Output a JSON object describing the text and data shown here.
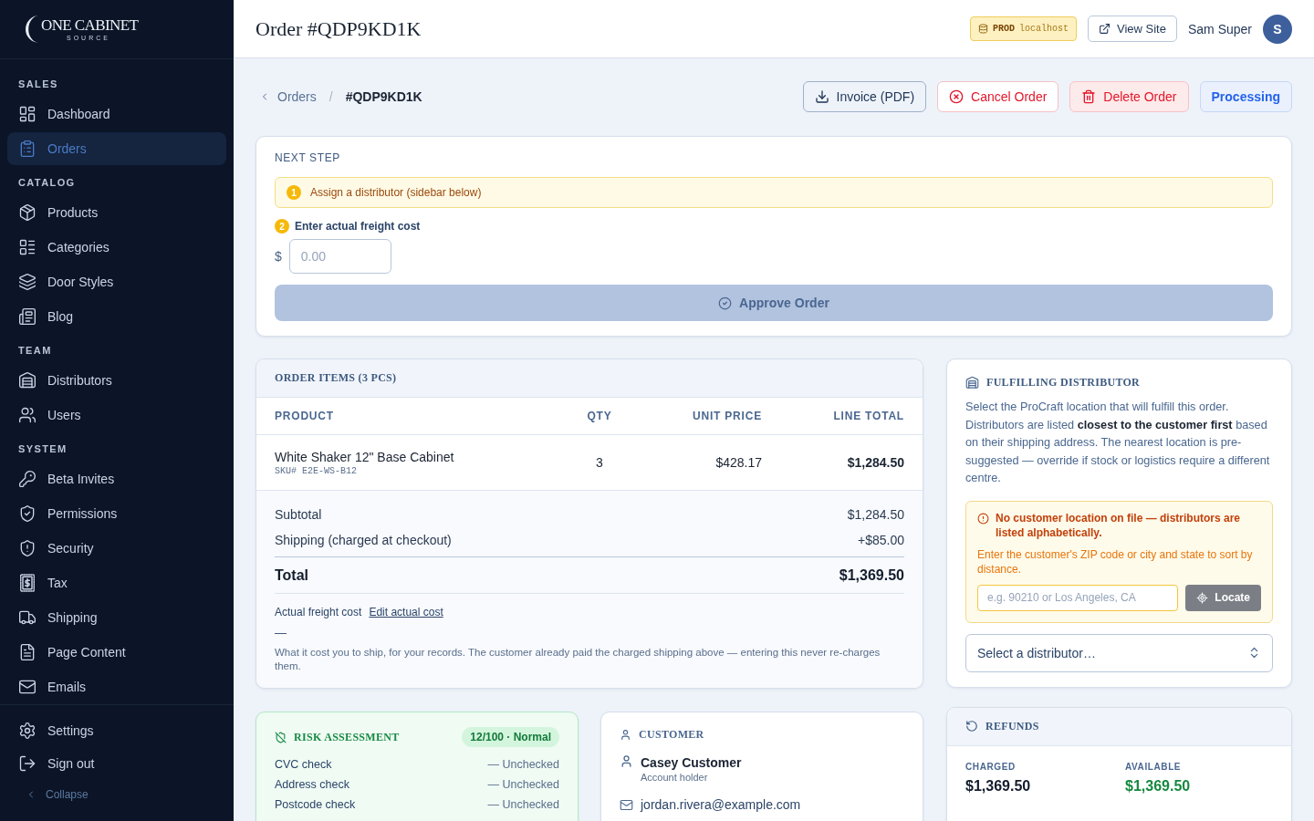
{
  "sidebar": {
    "logo": {
      "wordmark": "ONE CABINET",
      "tagline": "SOURCE"
    },
    "sections": [
      {
        "label": "SALES",
        "items": [
          {
            "label": "Dashboard",
            "selected": false
          },
          {
            "label": "Orders",
            "selected": true
          }
        ]
      },
      {
        "label": "CATALOG",
        "items": [
          {
            "label": "Products",
            "selected": false
          },
          {
            "label": "Categories",
            "selected": false
          },
          {
            "label": "Door Styles",
            "selected": false
          },
          {
            "label": "Blog",
            "selected": false
          }
        ]
      },
      {
        "label": "TEAM",
        "items": [
          {
            "label": "Distributors",
            "selected": false
          },
          {
            "label": "Users",
            "selected": false
          }
        ]
      },
      {
        "label": "SYSTEM",
        "items": [
          {
            "label": "Beta Invites",
            "selected": false
          },
          {
            "label": "Permissions",
            "selected": false
          },
          {
            "label": "Security",
            "selected": false
          },
          {
            "label": "Tax",
            "selected": false
          },
          {
            "label": "Shipping",
            "selected": false
          },
          {
            "label": "Page Content",
            "selected": false
          },
          {
            "label": "Emails",
            "selected": false
          }
        ]
      }
    ],
    "footer_items": [
      {
        "label": "Settings"
      },
      {
        "label": "Sign out"
      }
    ],
    "collapse": "Collapse"
  },
  "header": {
    "title": "Order #QDP9KD1K",
    "env_badge": {
      "env": "PROD",
      "host": "localhost"
    },
    "view_site": "View Site",
    "user": {
      "name": "Sam Super",
      "initial": "S"
    }
  },
  "breadcrumb": {
    "parent": "Orders",
    "separator": "/",
    "current": "#QDP9KD1K"
  },
  "actions": [
    {
      "label": "Invoice (PDF)",
      "kind": "neutral"
    },
    {
      "label": "Cancel Order",
      "kind": "danger-outline"
    },
    {
      "label": "Delete Order",
      "kind": "danger"
    },
    {
      "label": "Processing",
      "kind": "status"
    }
  ],
  "next_step": {
    "title": "NEXT STEP",
    "steps": [
      {
        "number": "1",
        "text": "Assign a distributor (sidebar below)",
        "kind": "alert"
      },
      {
        "number": "2",
        "text": "Enter actual freight cost",
        "kind": "input",
        "currency": "$",
        "placeholder": "0.00"
      }
    ],
    "approve": {
      "label": "Approve Order",
      "disabled": true
    }
  },
  "order_items": {
    "title": "ORDER ITEMS (3 PCS)",
    "columns": [
      "PRODUCT",
      "QTY",
      "UNIT PRICE",
      "LINE TOTAL"
    ],
    "rows": [
      {
        "product": "White Shaker 12\" Base Cabinet",
        "sku": "SKU# E2E-WS-B12",
        "qty": "3",
        "unit_price": "$428.17",
        "line_total": "$1,284.50"
      }
    ],
    "summary": [
      {
        "label": "Subtotal",
        "value": "$1,284.50",
        "kind": "line"
      },
      {
        "label": "Shipping (charged at checkout)",
        "value": "+$85.00",
        "kind": "line"
      },
      {
        "label": "Total",
        "value": "$1,369.50",
        "kind": "total"
      }
    ],
    "freight": {
      "label": "Actual freight cost",
      "link": "Edit actual cost",
      "value": "—",
      "note": "What it cost you to ship, for your records. The customer already paid the charged shipping above — entering this never re-charges them."
    }
  },
  "distributor": {
    "title": "FULFILLING DISTRIBUTOR",
    "description": "Select the ProCraft location that will fulfill this order. Distributors are listed **closest to the customer first** based on their shipping address. The nearest location is pre-suggested — override if stock or logistics require a different centre.",
    "warning": {
      "title": "No customer location on file — distributors are listed alphabetically.",
      "text": "Enter the customer's ZIP code or city and state to sort by distance.",
      "placeholder": "e.g. 90210 or Los Angeles, CA",
      "button": "Locate"
    },
    "select": {
      "label": "Select a distributor…"
    }
  },
  "risk": {
    "title": "RISK ASSESSMENT",
    "score": "12/100 · Normal",
    "checks": [
      {
        "label": "CVC check",
        "value": "— Unchecked"
      },
      {
        "label": "Address check",
        "value": "— Unchecked"
      },
      {
        "label": "Postcode check",
        "value": "— Unchecked"
      }
    ]
  },
  "customer": {
    "title": "CUSTOMER",
    "name": "Casey Customer",
    "role": "Account holder",
    "email": "jordan.rivera@example.com"
  },
  "refunds": {
    "title": "REFUNDS",
    "amounts": [
      {
        "label": "CHARGED",
        "value": "$1,369.50",
        "color": "#131c2c"
      },
      {
        "label": "AVAILABLE",
        "value": "$1,369.50",
        "color": "#16883f"
      }
    ]
  }
}
